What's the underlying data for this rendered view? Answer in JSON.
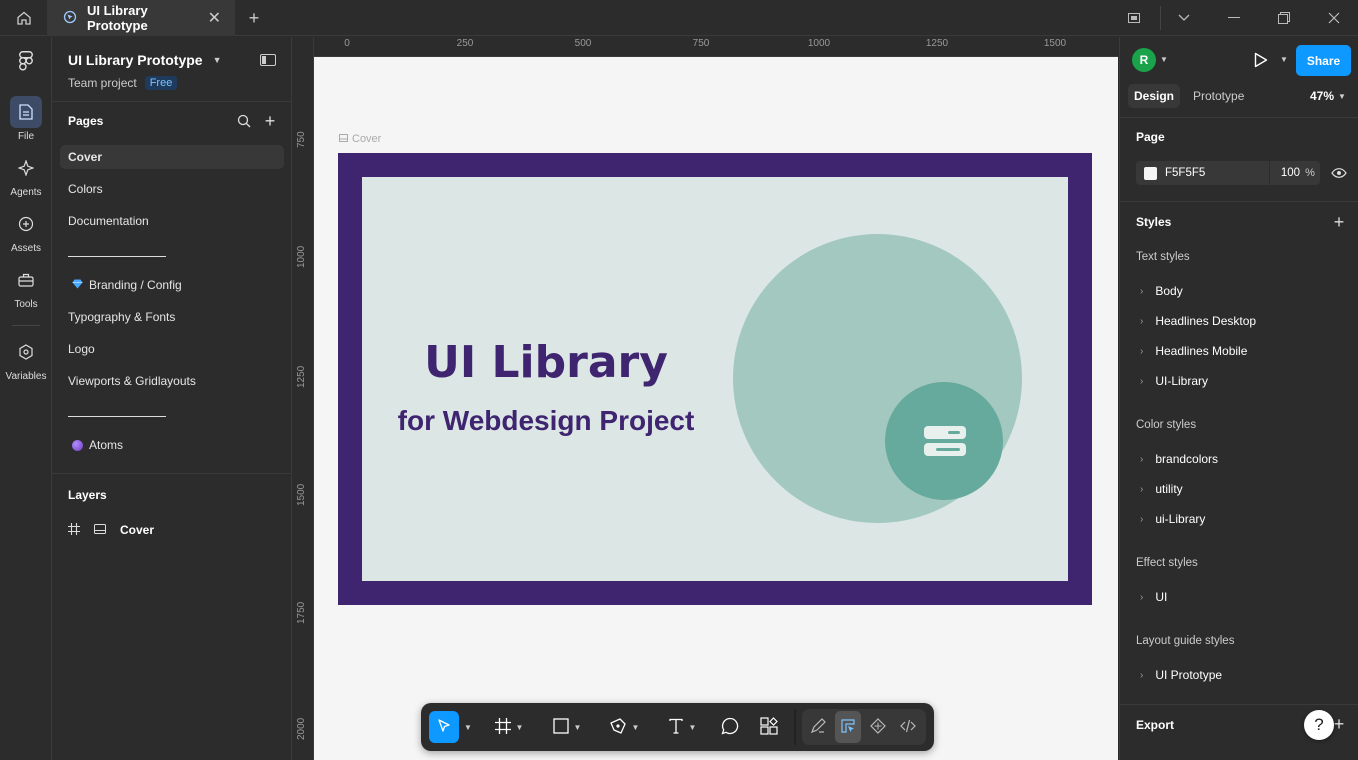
{
  "tab": {
    "title": "UI Library Prototype"
  },
  "rail": {
    "file": "File",
    "agents": "Agents",
    "assets": "Assets",
    "tools": "Tools",
    "variables": "Variables"
  },
  "project": {
    "name": "UI Library Prototype",
    "team": "Team project",
    "plan": "Free"
  },
  "pages": {
    "header": "Pages",
    "items": [
      "Cover",
      "Colors",
      "Documentation",
      "Branding / Config",
      "Typography & Fonts",
      "Logo",
      "Viewports & Gridlayouts",
      "Atoms"
    ]
  },
  "layers": {
    "header": "Layers",
    "items": [
      "Cover"
    ]
  },
  "canvas": {
    "frame_label": "Cover",
    "title": "UI Library",
    "subtitle": "for Webdesign Project",
    "ruler_x": [
      "0",
      "250",
      "500",
      "750",
      "1000",
      "1250",
      "1500"
    ],
    "ruler_y": [
      "750",
      "1000",
      "1250",
      "1500",
      "1750",
      "2000"
    ],
    "colors": {
      "frame_border": "#3f2570",
      "frame_bg": "#dce7e5",
      "circle_large": "#a3c8c0",
      "circle_small": "#65aa9c",
      "title": "#3f2570"
    }
  },
  "right": {
    "avatar": "R",
    "share": "Share",
    "tabs": [
      "Design",
      "Prototype"
    ],
    "zoom": "47%",
    "page": {
      "header": "Page",
      "color": "F5F5F5",
      "opacity": "100",
      "unit": "%"
    },
    "styles": {
      "header": "Styles",
      "text_header": "Text styles",
      "text": [
        "Body",
        "Headlines Desktop",
        "Headlines Mobile",
        "UI-Library"
      ],
      "color_header": "Color styles",
      "color": [
        "brandcolors",
        "utility",
        "ui-Library"
      ],
      "effect_header": "Effect styles",
      "effect": [
        "UI"
      ],
      "layout_header": "Layout guide styles",
      "layout": [
        "UI Prototype"
      ]
    },
    "export": "Export",
    "help": "?"
  },
  "accent": "#0d99ff"
}
